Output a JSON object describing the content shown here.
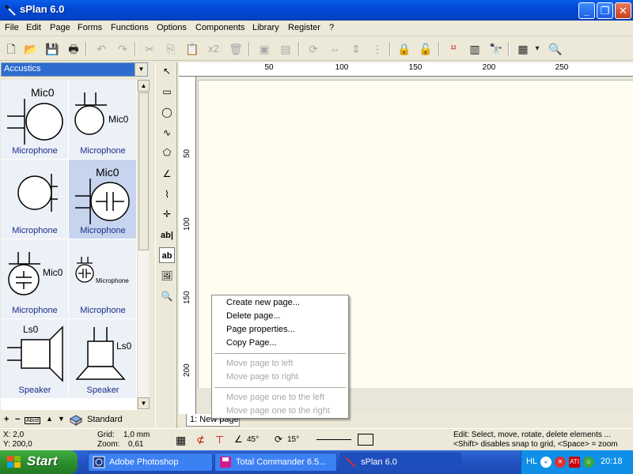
{
  "window": {
    "title": "sPlan 6.0",
    "minimize": "_",
    "restore": "❐",
    "close": "✕"
  },
  "menu": [
    "File",
    "Edit",
    "Page",
    "Forms",
    "Functions",
    "Options",
    "Components",
    "Library",
    "Register",
    "?"
  ],
  "toolbar": {
    "new": "🗋",
    "open": "📂",
    "save": "💾",
    "print": "🖶",
    "undo": "↶",
    "redo": "↷",
    "cut": "✂",
    "copy": "⎘",
    "paste": "📋",
    "x2": "x2",
    "delete": "🗑",
    "group": "▣",
    "ungroup": "▤",
    "rotate": "⟳",
    "mirror_h": "⇔",
    "mirror_v": "⇕",
    "align": "⋮",
    "lock": "🔒",
    "unlock": "🔓",
    "numbering": "¹²",
    "bom": "▥",
    "find": "🔭",
    "grid": "▦",
    "dropdown": "▾",
    "zoom": "🔍"
  },
  "library": {
    "category": "Accustics",
    "items": [
      {
        "name": "Microphone",
        "tag": "Mic0",
        "kind": "mic-big"
      },
      {
        "name": "Microphone",
        "tag": "Mic0",
        "kind": "mic-small"
      },
      {
        "name": "Microphone",
        "tag": "",
        "kind": "mic-plain"
      },
      {
        "name": "Microphone",
        "tag": "Mic0",
        "kind": "mic-cap"
      },
      {
        "name": "Microphone",
        "tag": "Mic0",
        "kind": "mic-cap-small"
      },
      {
        "name": "Microphone",
        "tag": "Microphone",
        "kind": "mic-cap-tiny"
      },
      {
        "name": "Speaker",
        "tag": "Ls0",
        "kind": "speaker"
      },
      {
        "name": "Speaker",
        "tag": "Ls0",
        "kind": "speaker-down"
      }
    ],
    "bottom": {
      "add": "+",
      "remove": "−",
      "rename": "Abcd",
      "up": "▲",
      "down": "▼",
      "book_label": "Standard"
    }
  },
  "tools": {
    "select": "↖",
    "rect": "▭",
    "ellipse": "◯",
    "freehand": "∿",
    "polygon": "⬠",
    "line": "∠",
    "bezier": "⌇",
    "junction": "✛",
    "text": "ab|",
    "textbox": "ab",
    "image": "🖼",
    "zoom": "🔍"
  },
  "ruler": {
    "top": [
      "50",
      "100",
      "150",
      "200",
      "250"
    ],
    "left": [
      "50",
      "100",
      "150",
      "200"
    ]
  },
  "page_tab": "1: New page",
  "context_menu": [
    {
      "label": "Create new page...",
      "enabled": true
    },
    {
      "label": "Delete page...",
      "enabled": true
    },
    {
      "label": "Page properties...",
      "enabled": true
    },
    {
      "label": "Copy Page...",
      "enabled": true
    },
    {
      "label": "Move page to left",
      "enabled": false
    },
    {
      "label": "Move page to right",
      "enabled": false
    },
    {
      "label": "Move page one to the left",
      "enabled": false
    },
    {
      "label": "Move page one to the right",
      "enabled": false
    }
  ],
  "status": {
    "x": "X: 2,0",
    "y": "Y: 200,0",
    "grid": "Grid:",
    "grid_value": "1,0 mm",
    "zoom": "Zoom:",
    "zoom_value": "0,61",
    "angle1": "45°",
    "angle2": "15°",
    "hint1": "Edit: Select, move, rotate, delete elements ...",
    "hint2": "<Shift> disables snap to grid, <Space> = zoom"
  },
  "taskbar": {
    "start": "Start",
    "tasks": [
      "Adobe Photoshop",
      "Total Commander 6.5...",
      "sPlan 6.0"
    ],
    "lang": "HL",
    "clock": "20:18"
  }
}
